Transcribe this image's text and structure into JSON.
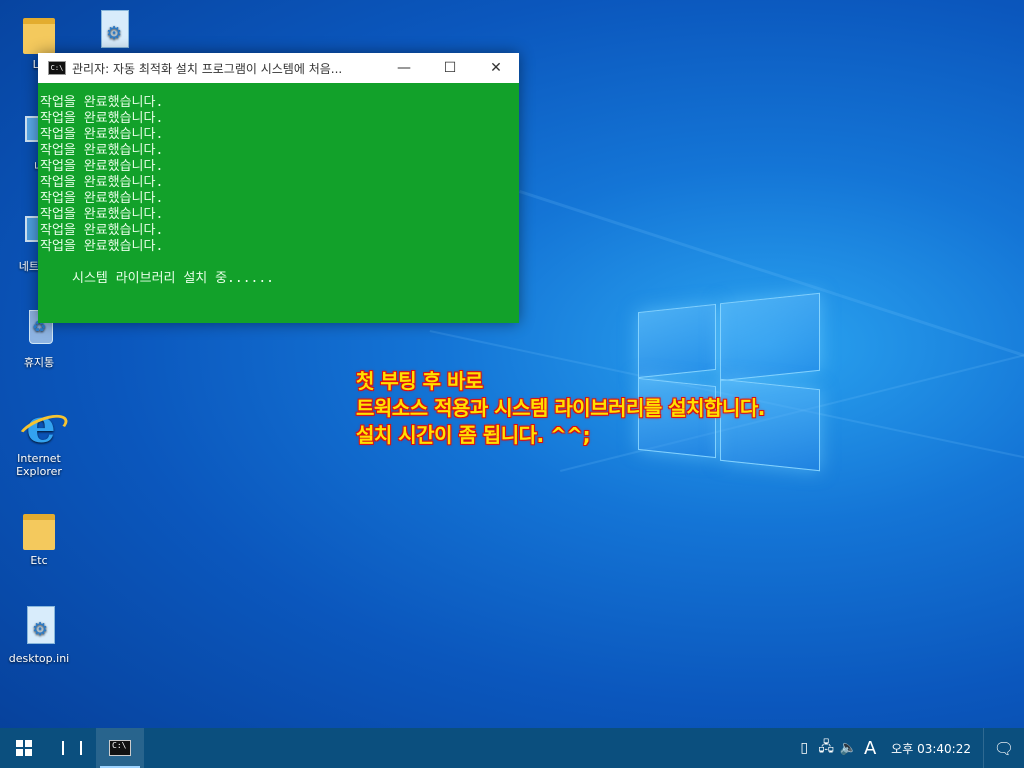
{
  "desktop": {
    "icons": [
      {
        "label": "Lo",
        "kind": "folder-user-icon"
      },
      {
        "label": "내",
        "kind": "computer-icon"
      },
      {
        "label": "네트워크",
        "kind": "network-icon"
      },
      {
        "label": "휴지통",
        "kind": "recycle-bin-icon"
      },
      {
        "label": "Internet Explorer",
        "kind": "internet-explorer-icon"
      },
      {
        "label": "Etc",
        "kind": "folder-icon"
      },
      {
        "label": "desktop.ini",
        "kind": "settings-file-icon"
      }
    ]
  },
  "console_window": {
    "title": "관리자: 자동 최적화 설치 프로그램이 시스템에 처음...",
    "lines": [
      "작업을 완료했습니다.",
      "작업을 완료했습니다.",
      "작업을 완료했습니다.",
      "작업을 완료했습니다.",
      "작업을 완료했습니다.",
      "작업을 완료했습니다.",
      "작업을 완료했습니다.",
      "작업을 완료했습니다.",
      "작업을 완료했습니다.",
      "작업을 완료했습니다."
    ],
    "status": "시스템 라이브러리 설치 중......",
    "background_color": "#12a12a",
    "buttons": {
      "minimize": "—",
      "maximize": "☐",
      "close": "✕"
    }
  },
  "caption": {
    "line1": "첫 부팅 후 바로",
    "line2": "트윅소스 적용과 시스템 라이브러리를 설치합니다.",
    "line3": "설치 시간이 좀 됩니다. ^^;",
    "text_color": "#ffe100",
    "outline_color": "#dd1111"
  },
  "taskbar": {
    "clock_ampm": "오후",
    "clock_time": "03:40:22",
    "input_indicator": "A",
    "tray_icons": [
      "usb-icon",
      "network-icon",
      "volume-icon"
    ]
  }
}
